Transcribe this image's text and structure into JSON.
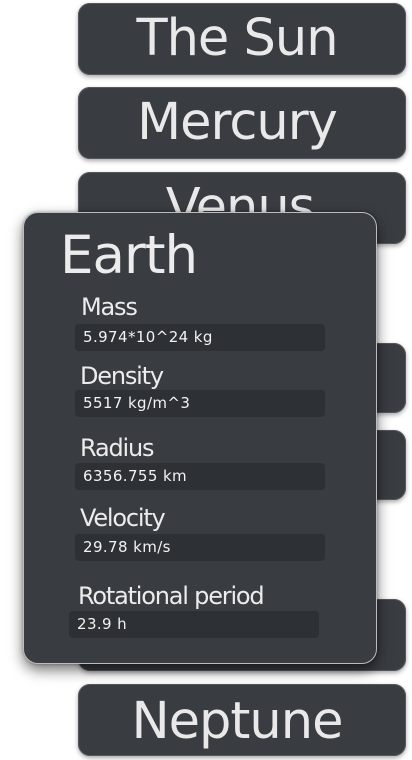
{
  "planets": {
    "sun": {
      "label": "The Sun"
    },
    "mercury": {
      "label": "Mercury"
    },
    "venus": {
      "label": "Venus"
    },
    "neptune": {
      "label": "Neptune"
    }
  },
  "detail": {
    "title": "Earth",
    "mass": {
      "label": "Mass",
      "value": "5.974*10^24 kg"
    },
    "density": {
      "label": "Density",
      "value": "5517 kg/m^3"
    },
    "radius": {
      "label": "Radius",
      "value": "6356.755 km"
    },
    "velocity": {
      "label": "Velocity",
      "value": "29.78 km/s"
    },
    "rotational_period": {
      "label": "Rotational period",
      "value": "23.9 h"
    }
  }
}
